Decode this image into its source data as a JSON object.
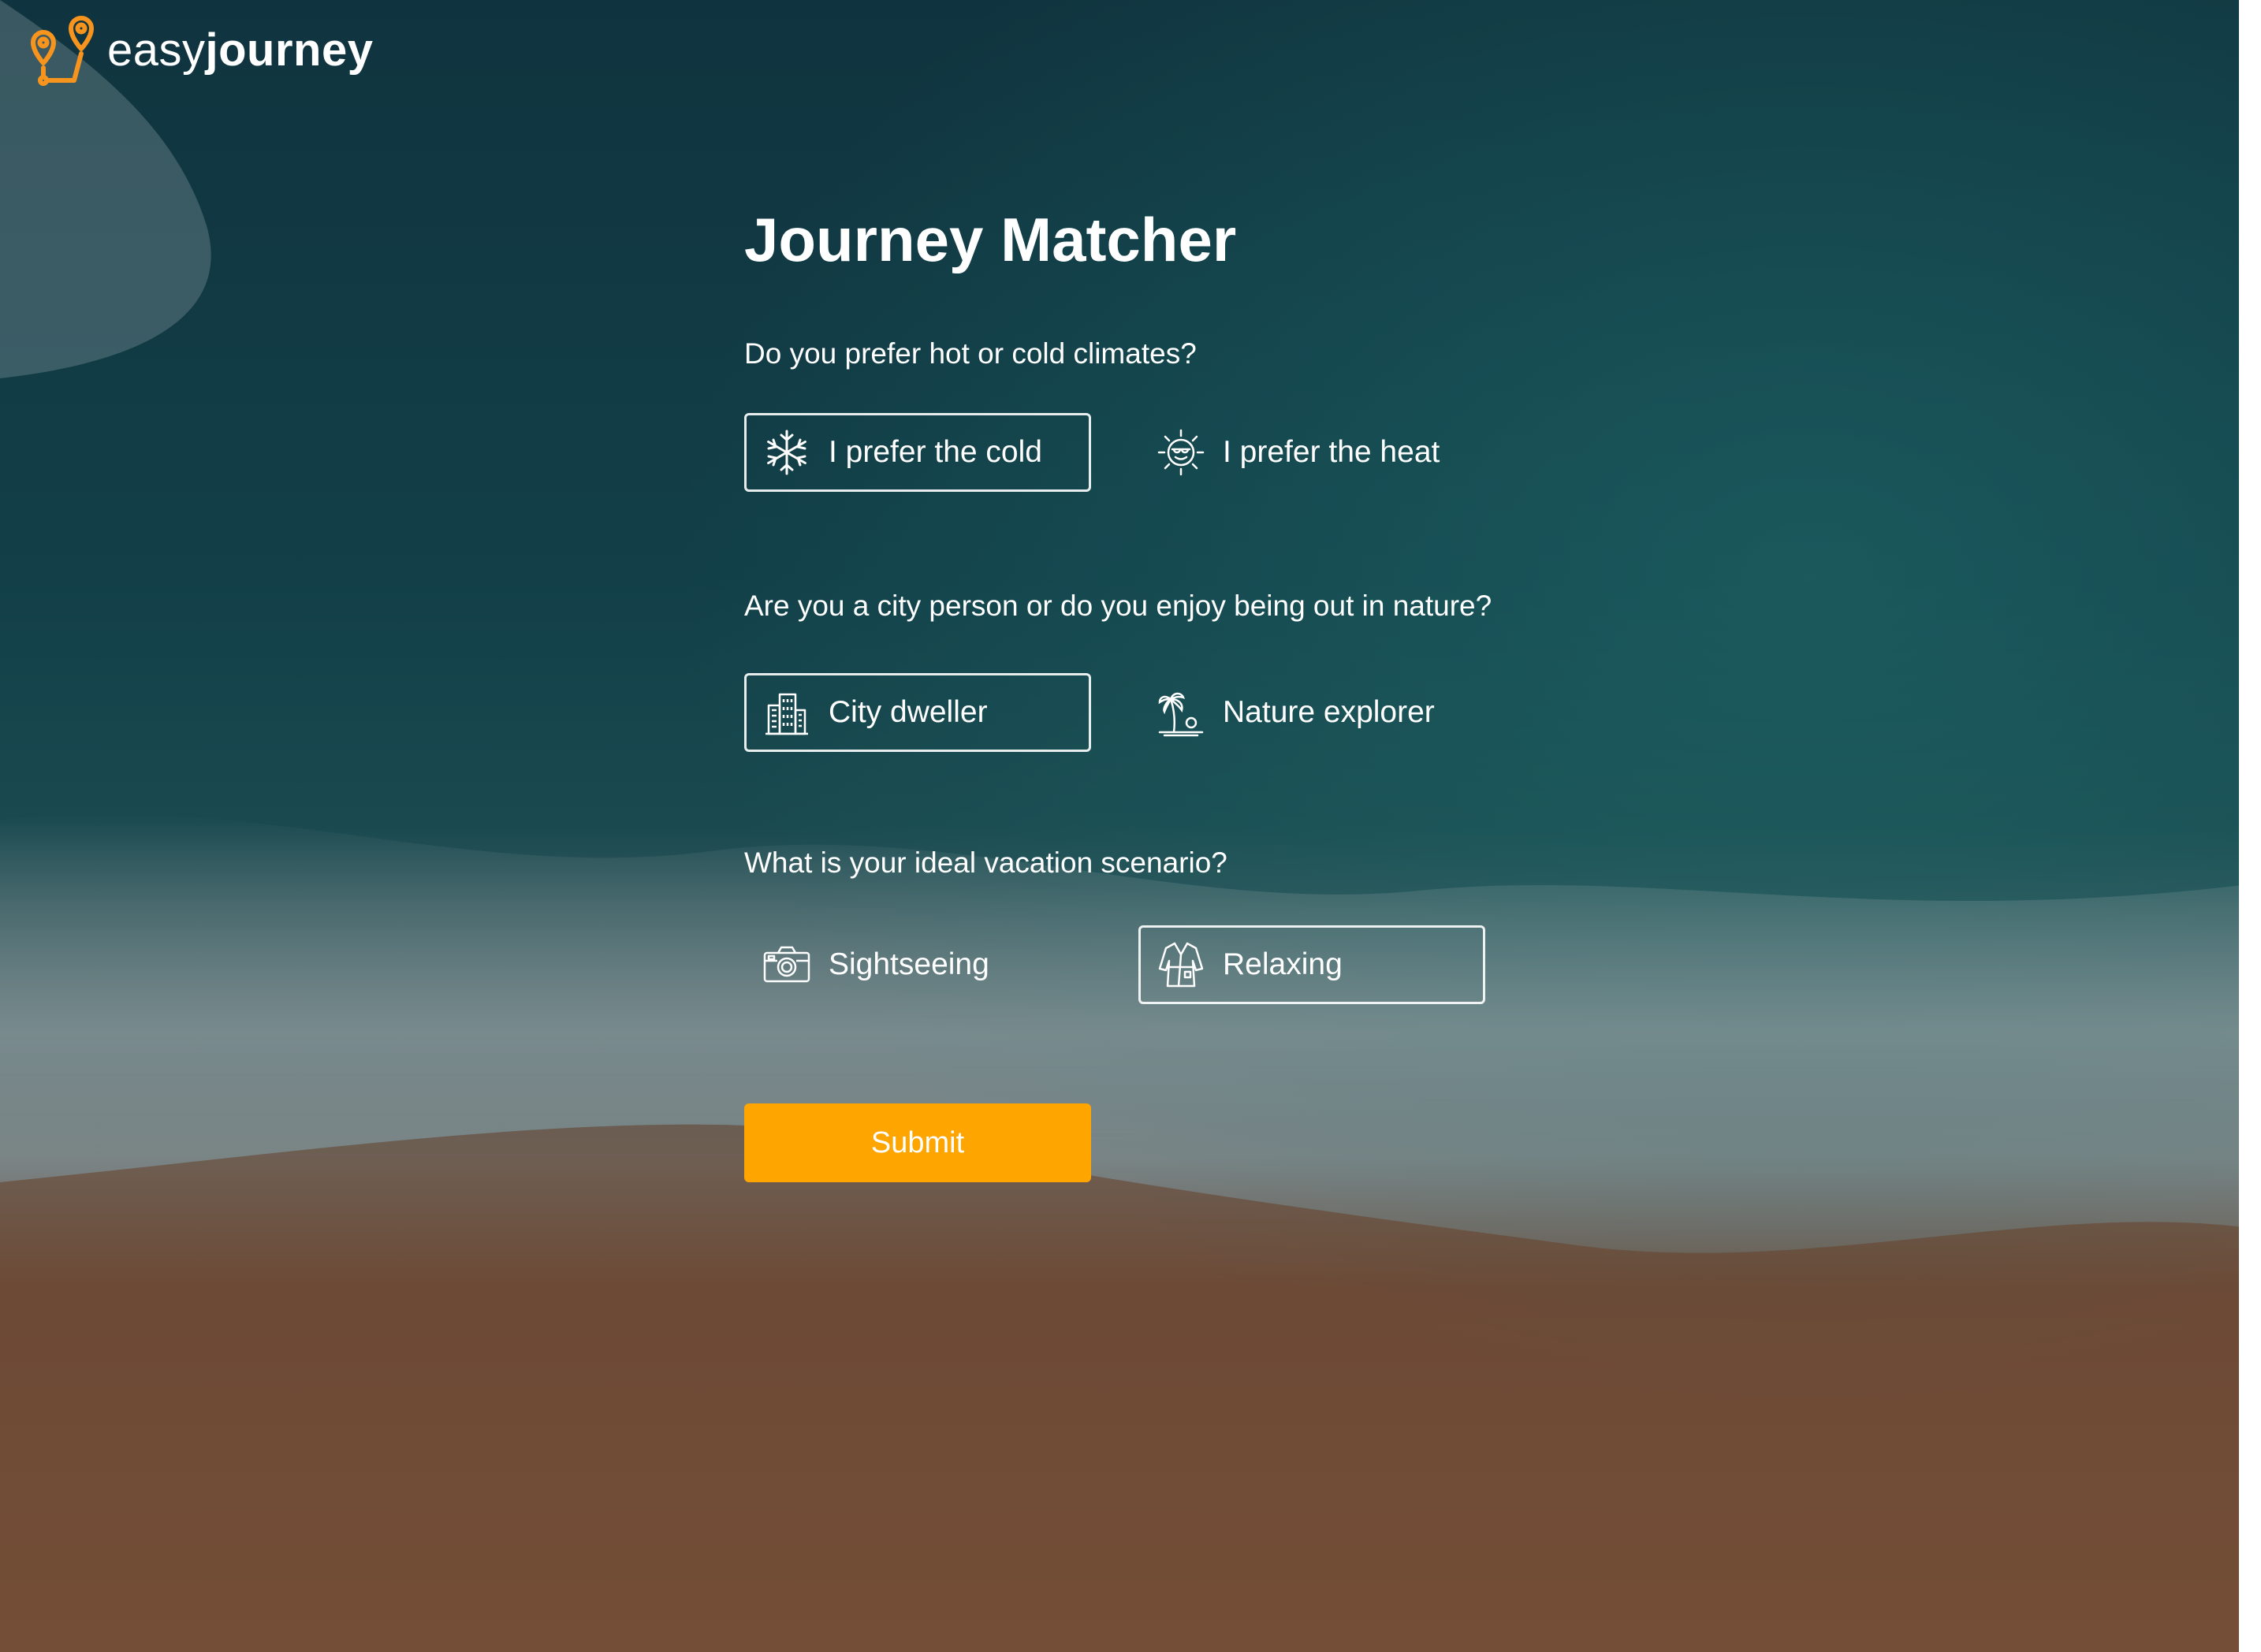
{
  "brand": {
    "name_light": "easy",
    "name_bold": "journey",
    "accent": "#F7941D"
  },
  "page": {
    "title": "Journey Matcher"
  },
  "questions": [
    {
      "text": "Do you prefer hot or cold climates?",
      "options": [
        {
          "label": "I prefer the cold",
          "icon": "snowflake-icon",
          "selected": true
        },
        {
          "label": "I prefer the heat",
          "icon": "sun-icon",
          "selected": false
        }
      ]
    },
    {
      "text": "Are you a city person or do you enjoy being out in nature?",
      "options": [
        {
          "label": "City dweller",
          "icon": "city-buildings-icon",
          "selected": true
        },
        {
          "label": "Nature explorer",
          "icon": "palm-tree-icon",
          "selected": false
        }
      ]
    },
    {
      "text": "What is your ideal vacation scenario?",
      "options": [
        {
          "label": "Sightseeing",
          "icon": "camera-icon",
          "selected": false
        },
        {
          "label": "Relaxing",
          "icon": "bathrobe-icon",
          "selected": true
        }
      ]
    }
  ],
  "submit": {
    "label": "Submit",
    "color": "#FFA500"
  },
  "colors": {
    "ocean_deep": "#0f3b45",
    "surf": "#8fa4a8",
    "sand": "#7a4a30",
    "text": "#FFFFFF"
  }
}
